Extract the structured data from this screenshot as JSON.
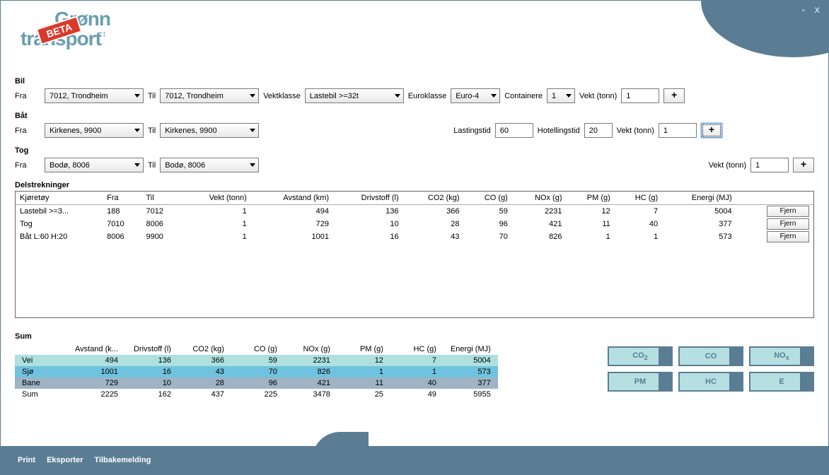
{
  "window": {
    "minimize": "▫",
    "close": "X"
  },
  "logo": {
    "line1": "Grønn",
    "line2": "transport",
    "beta": "BETA"
  },
  "bil": {
    "title": "Bil",
    "fra_label": "Fra",
    "fra_value": "7012, Trondheim",
    "til_label": "Til",
    "til_value": "7012, Trondheim",
    "vektklasse_label": "Vektklasse",
    "vektklasse_value": "Lastebil >=32t",
    "euroklasse_label": "Euroklasse",
    "euroklasse_value": "Euro-4",
    "containere_label": "Containere",
    "containere_value": "1",
    "vekt_label": "Vekt (tonn)",
    "vekt_value": "1",
    "plus": "+"
  },
  "bat": {
    "title": "Båt",
    "fra_label": "Fra",
    "fra_value": "Kirkenes, 9900",
    "til_label": "Til",
    "til_value": "Kirkenes, 9900",
    "lastingstid_label": "Lastingstid",
    "lastingstid_value": "60",
    "hotellingstid_label": "Hotellingstid",
    "hotellingstid_value": "20",
    "vekt_label": "Vekt (tonn)",
    "vekt_value": "1",
    "plus": "+"
  },
  "tog": {
    "title": "Tog",
    "fra_label": "Fra",
    "fra_value": "Bodø, 8006",
    "til_label": "Til",
    "til_value": "Bodø, 8006",
    "vekt_label": "Vekt (tonn)",
    "vekt_value": "1",
    "plus": "+"
  },
  "del": {
    "title": "Delstrekninger",
    "headers": [
      "Kjøretøy",
      "Fra",
      "Til",
      "Vekt (tonn)",
      "Avstand (km)",
      "Drivstoff (l)",
      "CO2 (kg)",
      "CO (g)",
      "NOx (g)",
      "PM (g)",
      "HC (g)",
      "Energi (MJ)",
      ""
    ],
    "rows": [
      {
        "k": "Lastebil >=3...",
        "fra": "188",
        "til": "7012",
        "vekt": "1",
        "avstand": "494",
        "drivstoff": "136",
        "co2": "366",
        "co": "59",
        "nox": "2231",
        "pm": "12",
        "hc": "7",
        "energi": "5004"
      },
      {
        "k": "Tog",
        "fra": "7010",
        "til": "8006",
        "vekt": "1",
        "avstand": "729",
        "drivstoff": "10",
        "co2": "28",
        "co": "96",
        "nox": "421",
        "pm": "11",
        "hc": "40",
        "energi": "377"
      },
      {
        "k": "Båt L:60 H:20",
        "fra": "8006",
        "til": "9900",
        "vekt": "1",
        "avstand": "1001",
        "drivstoff": "16",
        "co2": "43",
        "co": "70",
        "nox": "826",
        "pm": "1",
        "hc": "1",
        "energi": "573"
      }
    ],
    "fjern": "Fjern"
  },
  "sum": {
    "title": "Sum",
    "headers": [
      "",
      "Avstand (k...",
      "Drivstoff (l)",
      "CO2 (kg)",
      "CO (g)",
      "NOx (g)",
      "PM (g)",
      "HC (g)",
      "Energi (MJ)"
    ],
    "rows": [
      {
        "name": "Vei",
        "cls": "vei",
        "vals": [
          "494",
          "136",
          "366",
          "59",
          "2231",
          "12",
          "7",
          "5004"
        ]
      },
      {
        "name": "Sjø",
        "cls": "sjo",
        "vals": [
          "1001",
          "16",
          "43",
          "70",
          "826",
          "1",
          "1",
          "573"
        ]
      },
      {
        "name": "Bane",
        "cls": "bane",
        "vals": [
          "729",
          "10",
          "28",
          "96",
          "421",
          "11",
          "40",
          "377"
        ]
      },
      {
        "name": "Sum",
        "cls": "total",
        "vals": [
          "2225",
          "162",
          "437",
          "225",
          "3478",
          "25",
          "49",
          "5955"
        ]
      }
    ]
  },
  "em_buttons": [
    {
      "label": "CO",
      "sub": "2",
      "fill": 18
    },
    {
      "label": "CO",
      "sub": "",
      "fill": 18
    },
    {
      "label": "NO",
      "sub": "x",
      "fill": 18
    },
    {
      "label": "PM",
      "sub": "",
      "fill": 18
    },
    {
      "label": "HC",
      "sub": "",
      "fill": 18
    },
    {
      "label": "E",
      "sub": "",
      "fill": 18
    }
  ],
  "footer": {
    "print": "Print",
    "eksporter": "Eksporter",
    "tilbakemelding": "Tilbakemelding"
  },
  "colors": {
    "brand": "#5a7d94",
    "light": "#b6dfe2"
  }
}
